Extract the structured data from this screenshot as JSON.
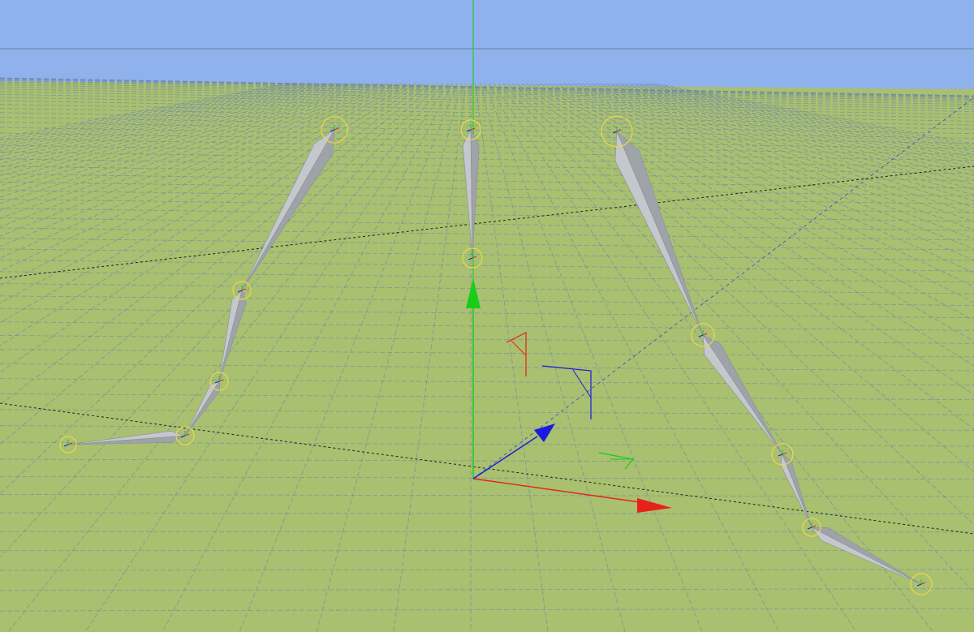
{
  "viewport": {
    "kind": "3d-viewport",
    "projection": "perspective",
    "colors": {
      "sky": "#8fb1ec",
      "ground": "#a8c070",
      "grid_line": "#6f86a8",
      "horizon_line": "#6f7fa0",
      "bone_fill": "#c4c8cc",
      "bone_shade": "#9ea3aa",
      "joint_ring": "#e8d84a",
      "axis_x": "#e8201c",
      "axis_y": "#18cc18",
      "axis_z": "#1a1ae0"
    }
  },
  "axes_gizmo": {
    "x_axis": {
      "color": "#e8201c",
      "icon": "arrow-cone"
    },
    "y_axis": {
      "color": "#18cc18",
      "icon": "arrow-cone"
    },
    "z_axis": {
      "color": "#1a1ae0",
      "icon": "arrow-cone"
    },
    "plane_markers": [
      "xy-corner",
      "yz-corner",
      "xz-corner"
    ]
  },
  "rig": {
    "chains": [
      {
        "name": "left-arm",
        "joints": 5,
        "bones": 4
      },
      {
        "name": "spine",
        "joints": 2,
        "bones": 1
      },
      {
        "name": "right-arm",
        "joints": 5,
        "bones": 4
      }
    ],
    "joint_marker": "ring-with-local-axes",
    "bone_shape": "octahedral"
  }
}
